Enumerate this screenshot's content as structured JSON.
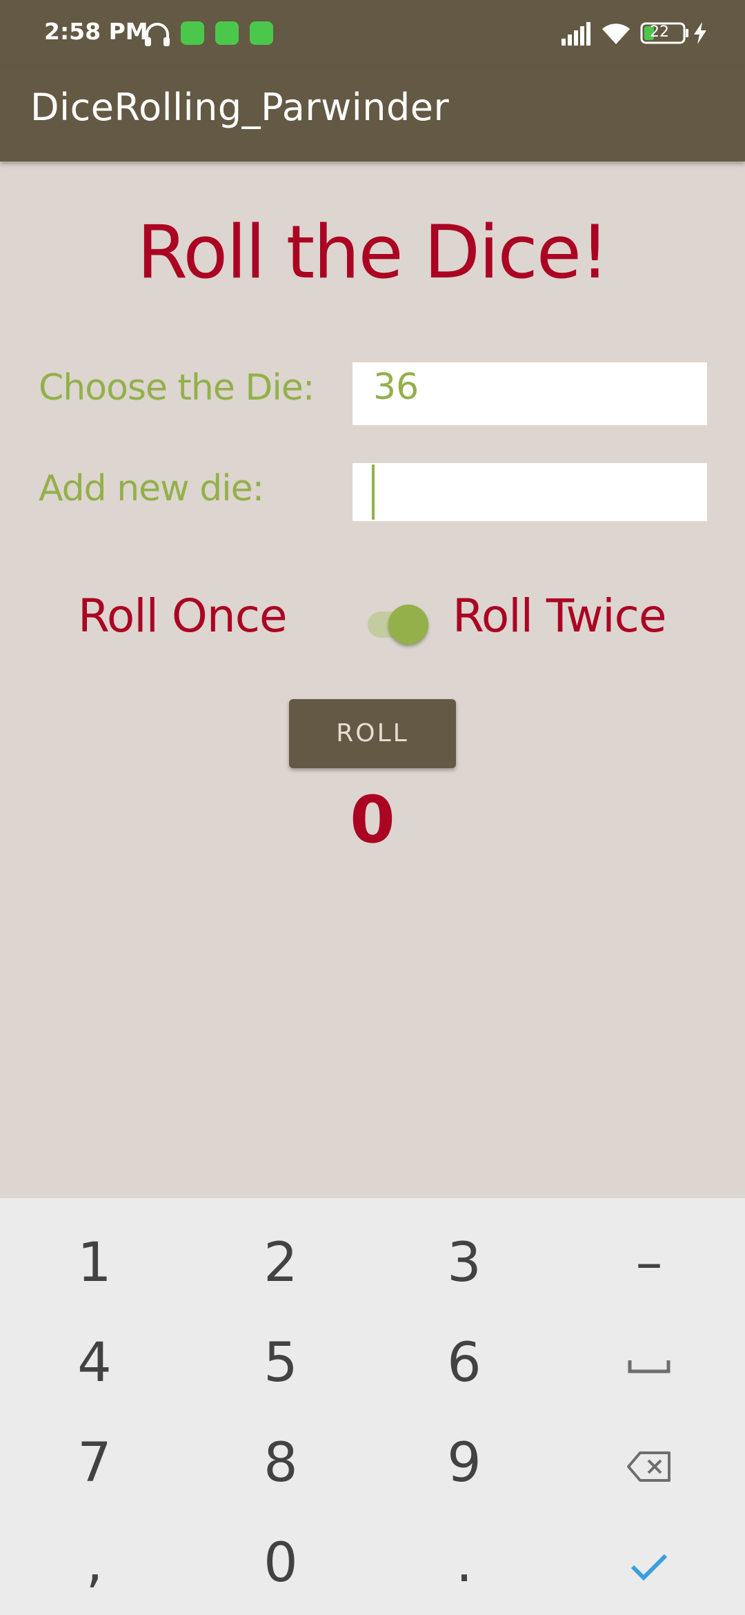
{
  "status_bar": {
    "time": "2:58 PM",
    "battery_level": "22",
    "icons": [
      "headphones-icon",
      "app-notification-icon",
      "app-notification-icon",
      "app-notification-icon",
      "signal-icon",
      "wifi-icon",
      "battery-icon",
      "charging-icon"
    ]
  },
  "app_bar": {
    "title": "DiceRolling_Parwinder"
  },
  "main": {
    "heading": "Roll the Dice!",
    "choose_die_label": "Choose the Die:",
    "choose_die_value": "36",
    "add_die_label": "Add new die:",
    "add_die_value": "",
    "roll_once_label": "Roll Once",
    "roll_twice_label": "Roll Twice",
    "roll_twice_switch_on": true,
    "roll_button_label": "ROLL",
    "result": "0"
  },
  "keyboard": {
    "rows": [
      [
        "1",
        "2",
        "3",
        "–"
      ],
      [
        "4",
        "5",
        "6",
        "space-icon"
      ],
      [
        "7",
        "8",
        "9",
        "backspace-icon"
      ],
      [
        ",",
        "0",
        ".",
        "checkmark-icon"
      ]
    ],
    "k1": "1",
    "k2": "2",
    "k3": "3",
    "minus": "–",
    "k4": "4",
    "k5": "5",
    "k6": "6",
    "k7": "7",
    "k8": "8",
    "k9": "9",
    "comma": ",",
    "k0": "0",
    "period": "."
  },
  "colors": {
    "primary": "#645944",
    "accent_red": "#ab0423",
    "accent_green": "#93b04a",
    "background": "#ddd5cf",
    "done_key": "#3a9ee0"
  }
}
